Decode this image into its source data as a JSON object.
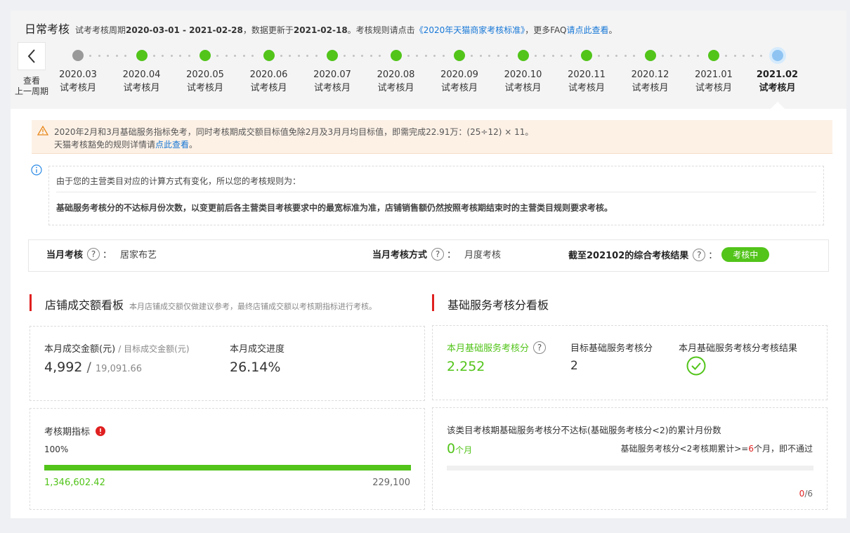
{
  "header": {
    "title": "日常考核",
    "period_prefix": "试考考核周期",
    "period_value": "2020-03-01 - 2021-02-28",
    "updated_prefix": "，数据更新于",
    "updated_value": "2021-02-18",
    "rule_prefix": "。考核规则请点击",
    "rule_link": "《2020年天猫商家考核标准》",
    "faq_prefix": "，更多FAQ",
    "faq_link": "请点此查看",
    "faq_suffix": "。"
  },
  "back": {
    "line1": "查看",
    "line2": "上一周期"
  },
  "timeline": [
    {
      "month": "2020.03",
      "label": "试考核月",
      "status": "grey"
    },
    {
      "month": "2020.04",
      "label": "试考核月",
      "status": "green"
    },
    {
      "month": "2020.05",
      "label": "试考核月",
      "status": "green"
    },
    {
      "month": "2020.06",
      "label": "试考核月",
      "status": "green"
    },
    {
      "month": "2020.07",
      "label": "试考核月",
      "status": "green"
    },
    {
      "month": "2020.08",
      "label": "试考核月",
      "status": "green"
    },
    {
      "month": "2020.09",
      "label": "试考核月",
      "status": "green"
    },
    {
      "month": "2020.10",
      "label": "试考核月",
      "status": "green"
    },
    {
      "month": "2020.11",
      "label": "试考核月",
      "status": "green"
    },
    {
      "month": "2020.12",
      "label": "试考核月",
      "status": "green"
    },
    {
      "month": "2021.01",
      "label": "试考核月",
      "status": "green"
    },
    {
      "month": "2021.02",
      "label": "试考核月",
      "status": "current"
    }
  ],
  "warning": {
    "icon": "warning-triangle-icon",
    "line1": "2020年2月和3月基础服务指标免考，同时考核期成交额目标值免除2月及3月月均目标值，即需完成22.91万：(25÷12) × 11。",
    "line2_prefix": "天猫考核豁免的规则详情请",
    "line2_link": "点此查看",
    "line2_suffix": "。"
  },
  "rule_notice": {
    "icon": "info-icon",
    "line1": "由于您的主营类目对应的计算方式有变化，所以您的考核规则为：",
    "line2": "基础服务考核分的不达标月份次数，以变更前后各主营类目考核要求中的最宽标准为准，店铺销售额仍然按照考核期结束时的主营类目规则要求考核。"
  },
  "assessment": {
    "current_label": "当月考核",
    "current_value": "居家布艺",
    "method_label": "当月考核方式",
    "method_value": "月度考核",
    "result_label": "截至202102的综合考核结果",
    "result_badge": "考核中",
    "colon": "：",
    "help": "?"
  },
  "sales_board": {
    "title": "店铺成交额看板",
    "note": "本月店铺成交额仅做建议参考，最终店铺成交额以考核期指标进行考核。",
    "amount_label": "本月成交金额(元)",
    "target_label": "/ 目标成交金额(元)",
    "amount_value": "4,992",
    "slash": "/",
    "target_value": "19,091.66",
    "progress_label": "本月成交进度",
    "progress_value": "26.14%",
    "period_label": "考核期指标",
    "period_percent": "100%",
    "period_progress": 1.0,
    "period_actual": "1,346,602.42",
    "period_target": "229,100"
  },
  "service_board": {
    "title": "基础服务考核分看板",
    "score_label": "本月基础服务考核分",
    "score_value": "2.252",
    "target_label": "目标基础服务考核分",
    "target_value": "2",
    "result_label": "本月基础服务考核分考核结果",
    "result_icon": "check-circle-icon",
    "fail_label": "该类目考核期基础服务考核分不达标(基础服务考核分<2)的累计月份数",
    "fail_count": "0",
    "fail_unit": "个月",
    "rule_prefix": "基础服务考核分<2考核期累计>=",
    "rule_num": "6",
    "rule_suffix": "个月，即不通过",
    "fail_progress": 0,
    "fail_current": "0",
    "fail_total": "/6"
  },
  "colors": {
    "green": "#52c41a",
    "current_node": "#8fc4f2",
    "section_bar": "#e02020",
    "link": "#1677d6",
    "warning_bg": "#fdf1e6"
  }
}
